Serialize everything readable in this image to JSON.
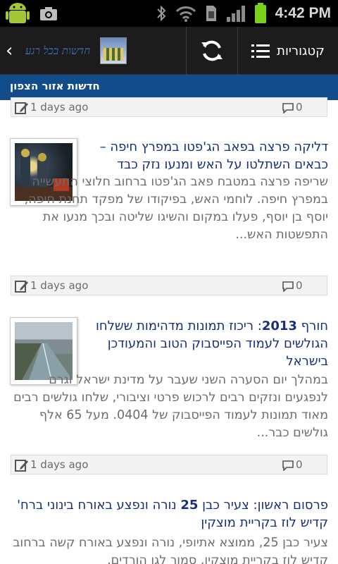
{
  "status_bar": {
    "time": "4:42 PM",
    "icons": [
      "android-icon",
      "camera-icon",
      "bluetooth-icon",
      "wifi-icon",
      "sim-icon",
      "signal-icon",
      "battery-icon"
    ]
  },
  "action_bar": {
    "logo_text": "חדשות בכל רגע",
    "categories_label": "קטגוריות"
  },
  "section": {
    "title": "חדשות אזור הצפון"
  },
  "meta_rows": [
    {
      "days": "1 days ago",
      "comments": "0"
    },
    {
      "days": "1 days ago",
      "comments": "0"
    },
    {
      "days": "1 days ago",
      "comments": "0"
    }
  ],
  "articles": [
    {
      "title": "דליקה פרצה בפאב הג'פטו במפרץ חיפה – כבאים השתלטו על האש ומנעו נזק כבד",
      "body": "שריפה פרצה במטבח פאב הג'פטו ברחוב חלוצי התעשייה במפרץ חיפה. לוחמי האש, בפיקודו של מפקד תחנת חיפה, יוסף בן יוסף, פעלו במקום והשיגו שליטה ובכך מנעו את התפשטות האש..."
    },
    {
      "title_prefix": "חורף ",
      "title_bold": "2013",
      "title_rest": ": ריכוז תמונות מדהימות ששלחו הגולשים לעמוד הפייסבוק הטוב והמעודכן בישראל",
      "body": "במהלך יום הסערה השני שעבר על מדינת ישראל וגרם לנפגעים ונזקים רבים לרכוש פרטי וציבורי, שלחו גולשים רבים מאוד תמונות לעמוד הפייסבוק של 0404. מעל 65 אלף גולשים כבר..."
    },
    {
      "title_prefix": "פרסום ראשון: צעיר כבן ",
      "title_bold": "25",
      "title_rest": " נורה ונפצע באורח בינוני ברח' קדיש לוז בקריית מוצקין",
      "body": "צעיר כבן 25, ממוצא אתיופי, נורה ונפצע באורח קשה ברחוב קדיש לוז בקריית מוצקין, סמוך לגן הורדים."
    }
  ],
  "colors": {
    "section_header": "#134c8b",
    "title": "#1a2f7c",
    "body": "#6d6d6d",
    "battery": "#7ad11b"
  }
}
